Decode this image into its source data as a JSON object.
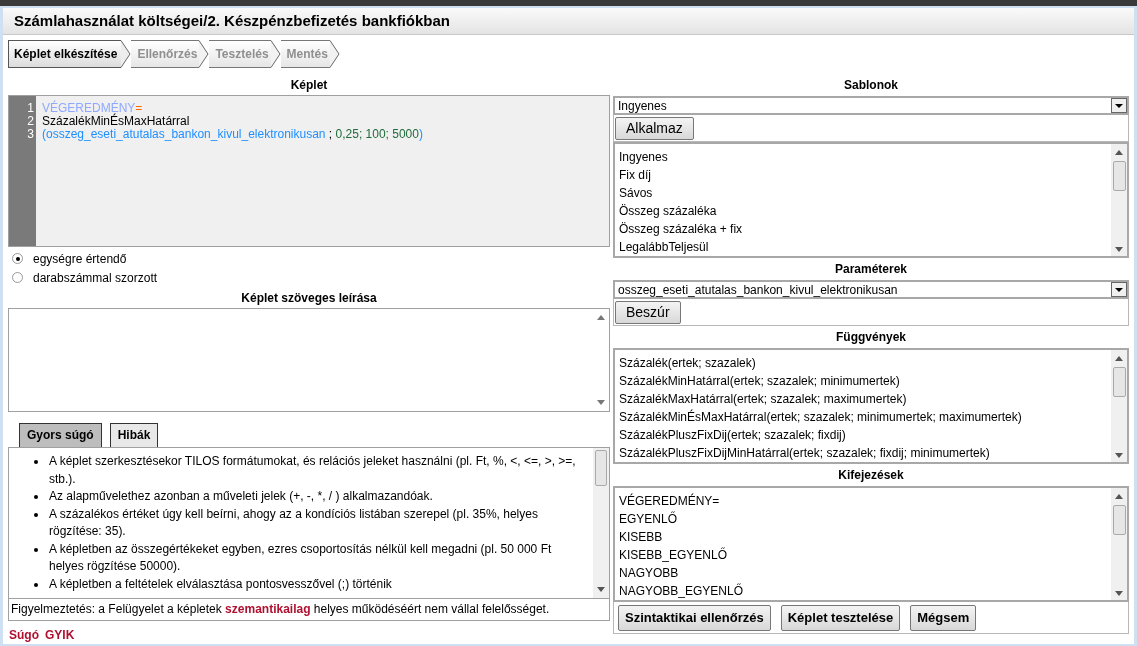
{
  "window": {
    "title": "Számlahasználat költségei/2. Készpénzbefizetés bankfiókban"
  },
  "steps": [
    {
      "label": "Képlet elkészítése",
      "selected": true
    },
    {
      "label": "Ellenőrzés",
      "selected": false
    },
    {
      "label": "Tesztelés",
      "selected": false
    },
    {
      "label": "Mentés",
      "selected": false
    }
  ],
  "formula": {
    "heading": "Képlet",
    "lines": [
      {
        "number": "1",
        "tokens": [
          {
            "text": "VÉGEREDMÉNY",
            "kind": "keyword"
          },
          {
            "text": "=",
            "kind": "operator"
          }
        ]
      },
      {
        "number": "2",
        "tokens": [
          {
            "text": "SzázalékMinÉsMaxHatárral",
            "kind": "function"
          }
        ]
      },
      {
        "number": "3",
        "tokens": [
          {
            "text": "(",
            "kind": "param"
          },
          {
            "text": "osszeg_eseti_atutalas_bankon_kivul_elektronikusan",
            "kind": "param"
          },
          {
            "text": " ; ",
            "kind": "function"
          },
          {
            "text": "0,25; 100; 5000",
            "kind": "number"
          },
          {
            "text": ")",
            "kind": "param"
          }
        ]
      }
    ]
  },
  "mode_options": [
    {
      "label": "egységre értendő",
      "selected": true
    },
    {
      "label": "darabszámmal szorzott",
      "selected": false
    }
  ],
  "description": {
    "heading": "Képlet szöveges leírása"
  },
  "help_tabs": [
    {
      "label": "Gyors súgó",
      "selected": true
    },
    {
      "label": "Hibák",
      "selected": false
    }
  ],
  "help_items": [
    "A képlet szerkesztésekor TILOS formátumokat, és relációs jeleket használni (pl. Ft, %, <, <=, >, >=, stb.).",
    "Az alapművelethez azonban a műveleti jelek (+, -, *, / ) alkalmazandóak.",
    "A százalékos értéket úgy kell beírni, ahogy az a kondíciós listában szerepel (pl. 35%, helyes rögzítése: 35).",
    "A képletben az összegértékeket egyben, ezres csoportosítás nélkül kell megadni (pl. 50 000 Ft helyes rögzítése 50000).",
    "A képletben a feltételek elválasztása pontosvesszővel (;) történik"
  ],
  "warning": "Figyelmeztetés: a Felügyelet a képletek **szemantikailag** helyes működéséért nem vállal felelősséget.",
  "footer_links": [
    "Súgó",
    "GYIK"
  ],
  "templates": {
    "heading": "Sablonok",
    "value": "Ingyenes",
    "button": "Alkalmaz",
    "items": [
      "Ingyenes",
      "Fix díj",
      "Sávos",
      "Összeg százaléka",
      "Összeg százaléka + fix",
      "LegalábbTeljesül"
    ]
  },
  "parameters": {
    "heading": "Paraméterek",
    "value": "osszeg_eseti_atutalas_bankon_kivul_elektronikusan",
    "button": "Beszúr"
  },
  "functions": {
    "heading": "Függvények",
    "items": [
      "Százalék(ertek; szazalek)",
      "SzázalékMinHatárral(ertek; szazalek; minimumertek)",
      "SzázalékMaxHatárral(ertek; szazalek; maximumertek)",
      "SzázalékMinÉsMaxHatárral(ertek; szazalek; minimumertek; maximumertek)",
      "SzázalékPluszFixDij(ertek; szazalek; fixdij)",
      "SzázalékPluszFixDijMinHatárral(ertek; szazalek; fixdij; minimumertek)"
    ]
  },
  "expressions": {
    "heading": "Kifejezések",
    "items": [
      "VÉGEREDMÉNY=",
      "EGYENLŐ",
      "KISEBB",
      "KISEBB_EGYENLŐ",
      "NAGYOBB",
      "NAGYOBB_EGYENLŐ"
    ]
  },
  "actions": [
    "Szintaktikai ellenőrzés",
    "Képlet tesztelése",
    "Mégsem"
  ]
}
